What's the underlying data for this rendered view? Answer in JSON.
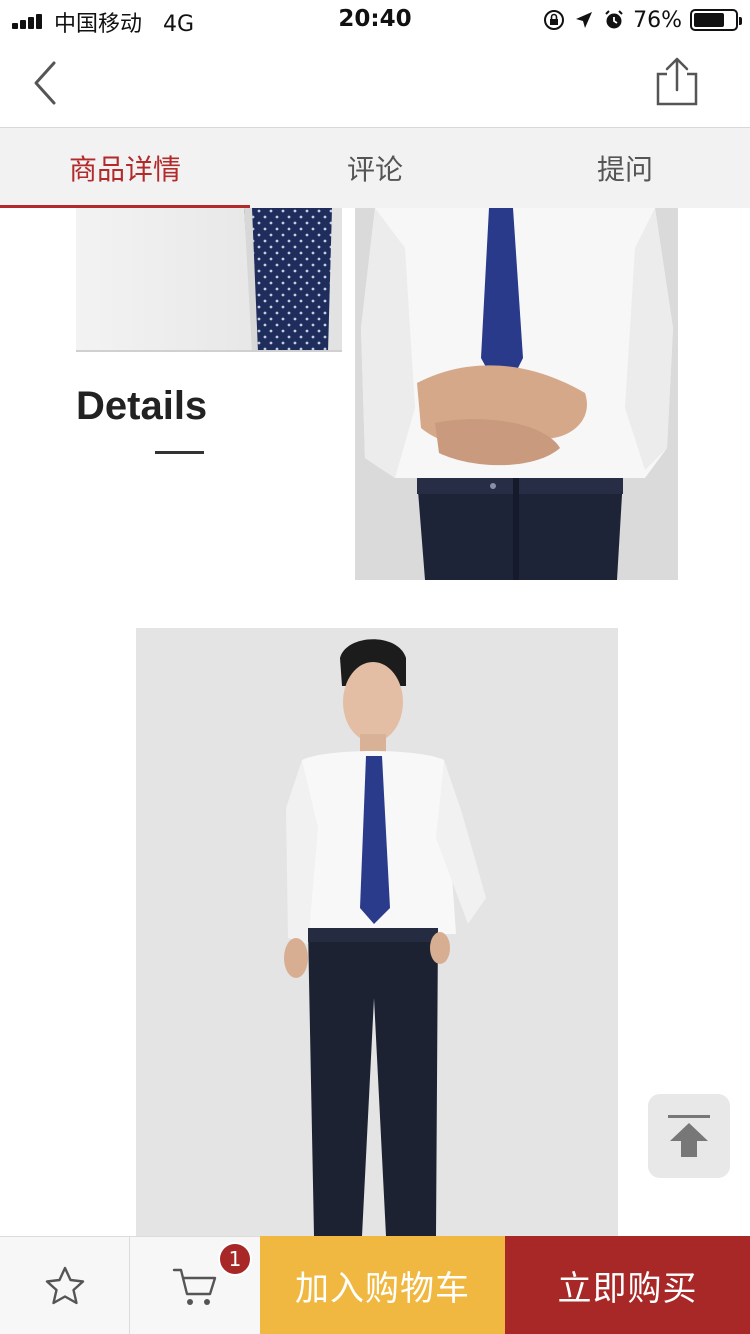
{
  "status_bar": {
    "carrier": "中国移动",
    "network": "4G",
    "time": "20:40",
    "battery_percent": "76%",
    "battery_level": 0.76,
    "icons": [
      "signal-icon",
      "orientation-lock-icon",
      "location-icon",
      "alarm-icon",
      "battery-icon"
    ]
  },
  "nav": {
    "back_icon": "chevron-left-icon",
    "share_icon": "share-icon"
  },
  "tabs": [
    {
      "label": "商品详情",
      "active": true
    },
    {
      "label": "评论",
      "active": false
    },
    {
      "label": "提问",
      "active": false
    }
  ],
  "content": {
    "details_heading": "Details",
    "photos": [
      "tie-closeup-photo",
      "shirt-tie-torso-photo",
      "full-body-model-photo"
    ]
  },
  "back_to_top": {
    "icon": "arrow-up-to-top-icon"
  },
  "bottom_bar": {
    "favorite_icon": "star-icon",
    "cart_icon": "cart-icon",
    "cart_count": "1",
    "add_to_cart": "加入购物车",
    "buy_now": "立即购买"
  },
  "colors": {
    "accent": "#b22a2a",
    "add_to_cart_bg": "#f0b840",
    "buy_now_bg": "#a82828",
    "tab_bar_bg": "#f2f2f2"
  }
}
